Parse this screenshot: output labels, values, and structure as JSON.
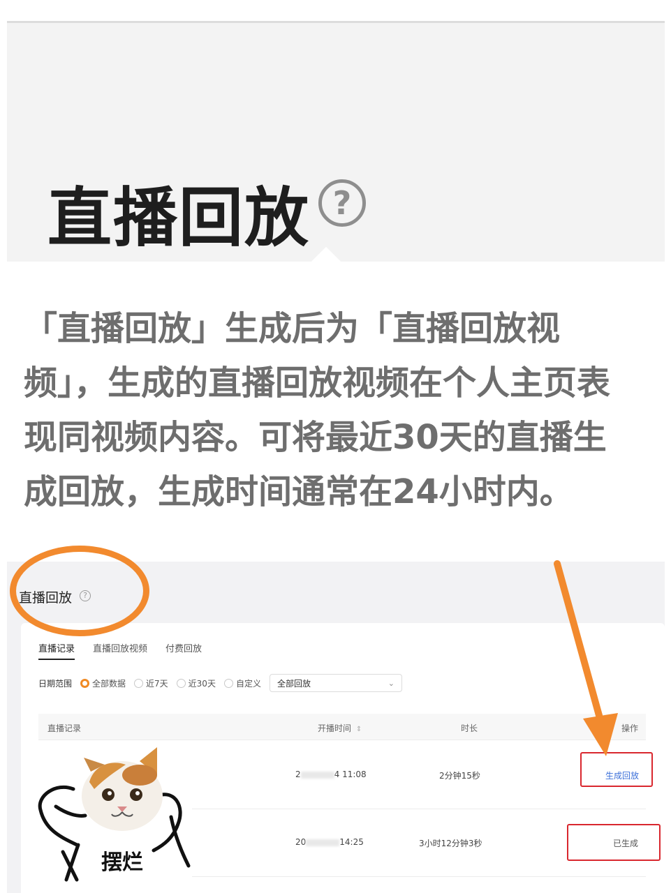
{
  "zoom": {
    "title": "直播回放",
    "help_icon": "question-circle-icon",
    "help_glyph": "?",
    "tooltip": "「直播回放」生成后为「直播回放视频」，生成的直播回放视频在个人主页表现同视频内容。可将最近30天的直播生成回放，生成时间通常在24小时内。"
  },
  "page": {
    "title": "直播回放",
    "help_glyph": "?",
    "tabs": [
      {
        "label": "直播记录",
        "active": true
      },
      {
        "label": "直播回放视频",
        "active": false
      },
      {
        "label": "付费回放",
        "active": false
      }
    ],
    "filter": {
      "label": "日期范围",
      "options": [
        {
          "label": "全部数据",
          "checked": true
        },
        {
          "label": "近7天",
          "checked": false
        },
        {
          "label": "近30天",
          "checked": false
        },
        {
          "label": "自定义",
          "checked": false
        }
      ],
      "select_value": "全部回放",
      "select_icon": "chevron-down-icon"
    },
    "table": {
      "headers": {
        "record": "直播记录",
        "start_time": "开播时间",
        "duration": "时长",
        "action": "操作"
      },
      "sort_glyph": "⇕",
      "rows": [
        {
          "time_prefix": "2",
          "time_suffix": "4 11:08",
          "duration": "2分钟15秒",
          "action": "生成回放"
        },
        {
          "time_prefix": "20",
          "time_suffix": "14:25",
          "duration": "3小时12分钟3秒",
          "action": "已生成"
        }
      ]
    }
  },
  "sticker": {
    "caption": "摆烂"
  },
  "colors": {
    "annotation_orange": "#f28a2e",
    "highlight_red": "#d9272e",
    "radio_orange": "#f08a24",
    "link_blue": "#3b6fd9"
  }
}
